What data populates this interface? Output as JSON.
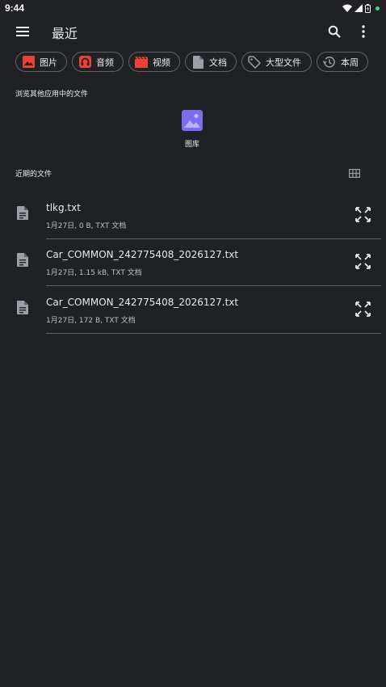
{
  "status_bar": {
    "time": "9:44"
  },
  "app_bar": {
    "title": "最近"
  },
  "chips": [
    {
      "label": "图片",
      "icon": "image-icon",
      "color": "#ea4335"
    },
    {
      "label": "音频",
      "icon": "headphones-icon",
      "color": "#ea4335"
    },
    {
      "label": "视频",
      "icon": "movie-icon",
      "color": "#ea4335"
    },
    {
      "label": "文档",
      "icon": "document-icon",
      "color": "#9aa0a6"
    },
    {
      "label": "大型文件",
      "icon": "tag-icon",
      "color": "#9aa0a6"
    },
    {
      "label": "本周",
      "icon": "history-icon",
      "color": "#9aa0a6"
    }
  ],
  "browse": {
    "label": "浏览其他应用中的文件",
    "roots": [
      {
        "label": "图库",
        "icon": "gallery-icon",
        "color": "#7c6cf0"
      }
    ]
  },
  "recent": {
    "label": "近期的文件",
    "files": [
      {
        "name": "tlkg.txt",
        "meta": "1月27日, 0 B, TXT 文档"
      },
      {
        "name": "Car_COMMON_242775408_2026127.txt",
        "meta": "1月27日, 1.15 kB, TXT 文档"
      },
      {
        "name": "Car_COMMON_242775408_2026127.txt",
        "meta": "1月27日, 172 B, TXT 文档"
      }
    ]
  }
}
